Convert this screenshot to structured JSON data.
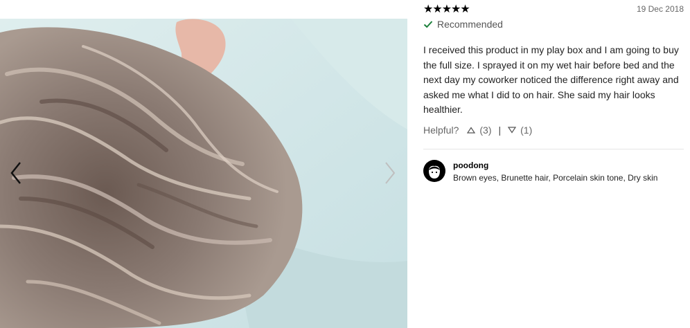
{
  "gallery": {
    "image_alt": "review-photo-hair",
    "prev_icon": "chevron-left-icon",
    "next_icon": "chevron-right-icon"
  },
  "review": {
    "stars": [
      "★",
      "★",
      "★",
      "★",
      "★"
    ],
    "rating": 5,
    "date": "19 Dec 2018",
    "recommended_label": "Recommended",
    "text": "I received this product in my play box and I am going to buy the full size. I sprayed it on my wet hair before bed and the next day my coworker noticed the difference right away and asked me what I did to on hair. She said my hair looks healthier.",
    "helpful_label": "Helpful?",
    "upvotes": "(3)",
    "separator": "|",
    "downvotes": "(1)"
  },
  "author": {
    "name": "poodong",
    "traits": "Brown eyes, Brunette hair, Porcelain skin tone, Dry skin"
  },
  "colors": {
    "check": "#1a7f3a",
    "star": "#000000",
    "divider": "#e5e5e5"
  }
}
